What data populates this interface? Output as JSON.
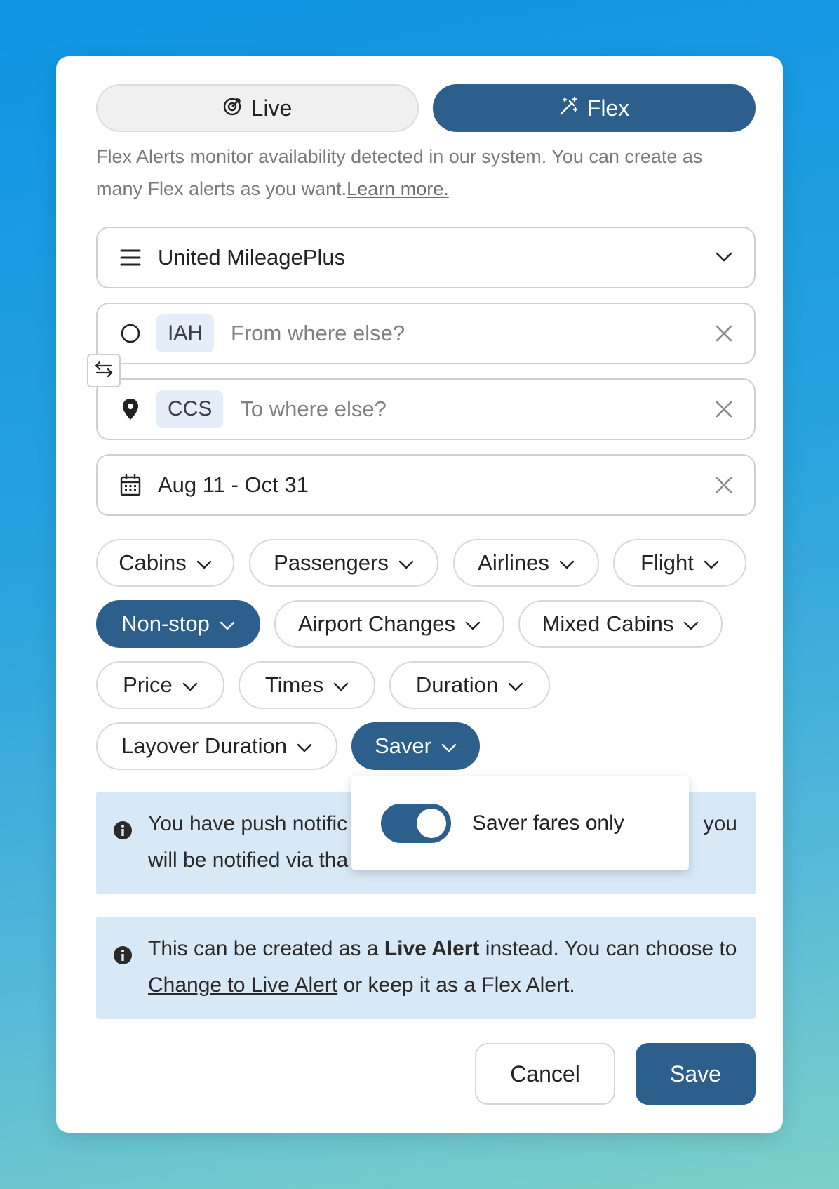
{
  "mode_toggle": {
    "live_label": "Live",
    "flex_label": "Flex",
    "active": "Flex"
  },
  "description": {
    "text": "Flex Alerts monitor availability detected in our system. You can create as many Flex alerts as you want.",
    "link": "Learn more."
  },
  "program": {
    "value": "United MileagePlus"
  },
  "origin": {
    "code": "IAH",
    "placeholder": "From where else?"
  },
  "destination": {
    "code": "CCS",
    "placeholder": "To where else?"
  },
  "dates": {
    "value": "Aug 11 - Oct 31"
  },
  "filters": [
    {
      "label": "Cabins",
      "active": false
    },
    {
      "label": "Passengers",
      "active": false
    },
    {
      "label": "Airlines",
      "active": false
    },
    {
      "label": "Flight",
      "active": false
    },
    {
      "label": "Non-stop",
      "active": true
    },
    {
      "label": "Airport Changes",
      "active": false
    },
    {
      "label": "Mixed Cabins",
      "active": false
    },
    {
      "label": "Price",
      "active": false
    },
    {
      "label": "Times",
      "active": false
    },
    {
      "label": "Duration",
      "active": false
    },
    {
      "label": "Layover Duration",
      "active": false
    },
    {
      "label": "Saver",
      "active": true
    }
  ],
  "saver_popover": {
    "toggle_on": true,
    "label": "Saver fares only"
  },
  "notice_push": {
    "line1_start": "You have push notific",
    "line1_end": "you",
    "line2_start": "will be notified via tha"
  },
  "notice_live": {
    "text_before": "This can be created as a ",
    "bold": "Live Alert",
    "text_middle": " instead. You can choose to ",
    "link": "Change to Live Alert",
    "text_after": " or keep it as a Flex Alert."
  },
  "actions": {
    "cancel_label": "Cancel",
    "save_label": "Save"
  },
  "colors": {
    "primary": "#2d5f8c",
    "info_bg": "#d7e9f7",
    "chip_bg": "#e5eef8"
  }
}
